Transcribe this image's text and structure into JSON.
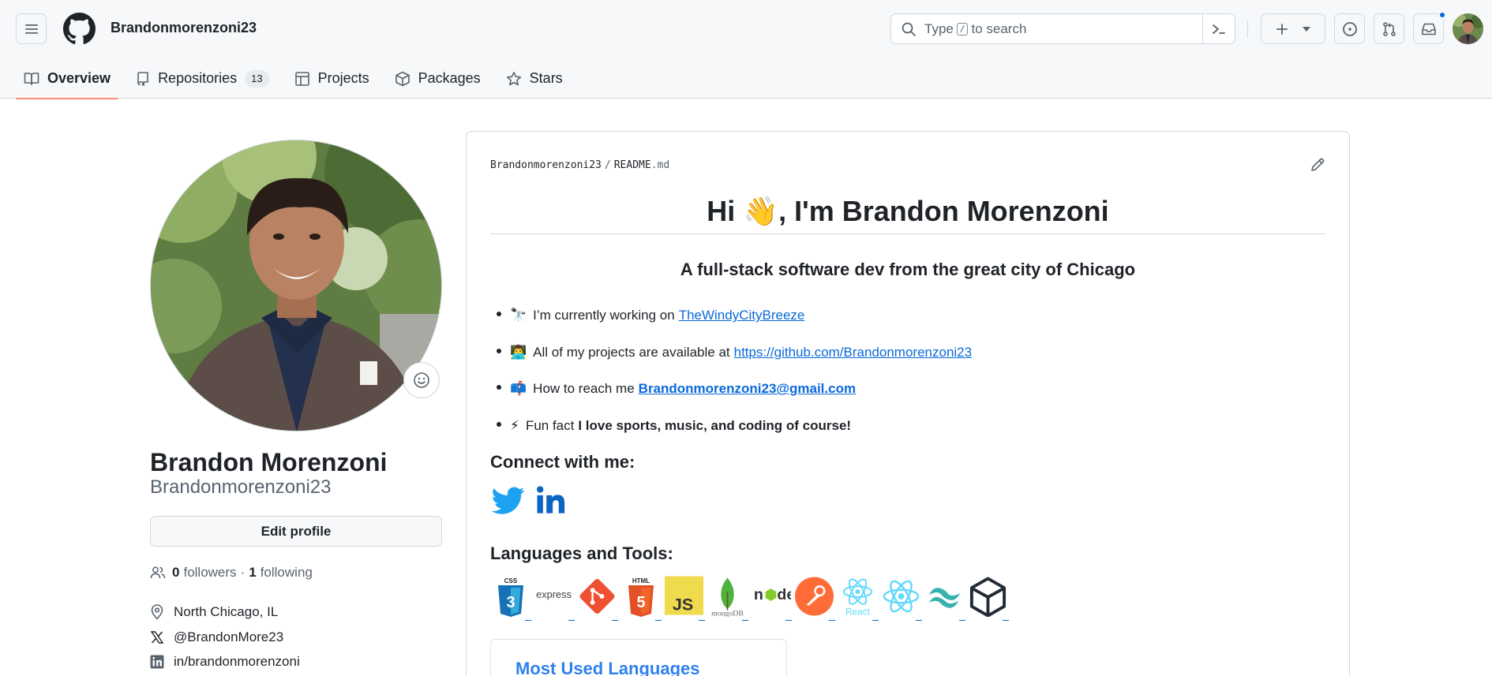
{
  "header": {
    "username": "Brandonmorenzoni23",
    "search_prefix": "Type",
    "search_key": "/",
    "search_suffix": "to search"
  },
  "tabs": [
    {
      "label": "Overview",
      "icon": "book-icon",
      "active": true
    },
    {
      "label": "Repositories",
      "icon": "repo-icon",
      "count": "13"
    },
    {
      "label": "Projects",
      "icon": "table-icon"
    },
    {
      "label": "Packages",
      "icon": "package-icon"
    },
    {
      "label": "Stars",
      "icon": "star-icon"
    }
  ],
  "profile": {
    "full_name": "Brandon Morenzoni",
    "login": "Brandonmorenzoni23",
    "edit_label": "Edit profile",
    "followers_count": "0",
    "followers_label": "followers",
    "dot": "·",
    "following_count": "1",
    "following_label": "following",
    "location": "North Chicago, IL",
    "twitter": "@BrandonMore23",
    "linkedin": "in/brandonmorenzoni"
  },
  "readme": {
    "path_owner": "Brandonmorenzoni23",
    "path_sep": "/",
    "path_file": "README",
    "path_ext": ".md",
    "title": "Hi 👋, I'm Brandon Morenzoni",
    "subtitle": "A full-stack software dev from the great city of Chicago",
    "items": [
      {
        "emoji": "🔭",
        "text": "I’m currently working on",
        "link": "TheWindyCityBreeze"
      },
      {
        "emoji": "👨‍💻",
        "text": "All of my projects are available at",
        "link": "https://github.com/Brandonmorenzoni23"
      },
      {
        "emoji": "📫",
        "text": "How to reach me",
        "link": "Brandonmorenzoni23@gmail.com"
      },
      {
        "emoji": "⚡",
        "text": "Fun fact",
        "bold": "I love sports, music, and coding of course!"
      }
    ],
    "connect_heading": "Connect with me:",
    "tools_heading": "Languages and Tools:",
    "tools": [
      "CSS3",
      "express",
      "git",
      "HTML5",
      "JS",
      "mongoDB",
      "node",
      "postman",
      "React",
      "react",
      "tailwind",
      "unity"
    ],
    "tool_labels": {
      "css": "CSS",
      "express": "express",
      "html": "HTML",
      "js": "JS",
      "mongo": "mongoDB",
      "react": "React"
    },
    "most_used_title": "Most Used Languages"
  },
  "colors": {
    "accent_tab": "#fd8c73",
    "link": "#0969da",
    "twitter": "#1DA1F2",
    "linkedin": "#0A66C2",
    "stats_title": "#2f80ed"
  }
}
